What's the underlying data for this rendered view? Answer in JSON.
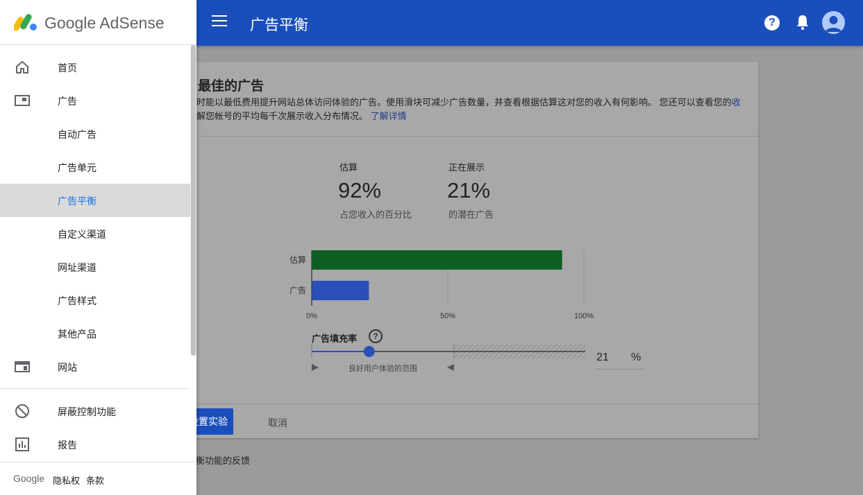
{
  "app": {
    "brand": "Google AdSense"
  },
  "topbar": {
    "title": "广告平衡"
  },
  "sidebar": {
    "items": [
      {
        "label": "首页",
        "icon": "home-icon"
      },
      {
        "label": "广告",
        "icon": "ads-icon"
      },
      {
        "label": "自动广告"
      },
      {
        "label": "广告单元"
      },
      {
        "label": "广告平衡",
        "active": true
      },
      {
        "label": "自定义渠道"
      },
      {
        "label": "网址渠道"
      },
      {
        "label": "广告样式"
      },
      {
        "label": "其他产品"
      },
      {
        "label": "网站",
        "icon": "sites-icon"
      },
      {
        "label": "屏蔽控制功能",
        "icon": "block-icon"
      },
      {
        "label": "报告",
        "icon": "reports-icon"
      }
    ],
    "footer": {
      "google": "Google",
      "privacy": "隐私权",
      "terms": "条款"
    }
  },
  "card": {
    "title": "最佳的广告",
    "desc_line1": "时能以最低费用提升网站总体访问体验的广告。使用滑块可减少广告数量，并查看根据估算这对您的收入有何影响。 您还可以查看您的",
    "desc_line1_link": "收",
    "desc_line2": "解您帐号的平均每千次展示收入分布情况。",
    "learn_more": "了解详情",
    "estimate": {
      "label": "估算",
      "value": "92%",
      "sub": "占您收入的百分比"
    },
    "showing": {
      "label": "正在展示",
      "value": "21%",
      "sub": "的潜在广告"
    },
    "fill_rate_label": "广告填充率",
    "fill_rate_value": "21",
    "fill_rate_unit": "%",
    "range_label": "良好用户体验的范围",
    "setup_button": "设置实验",
    "cancel_button": "取消",
    "feedback": "平衡功能的反馈"
  },
  "chart_data": {
    "type": "bar",
    "orientation": "horizontal",
    "categories": [
      "估算",
      "广告"
    ],
    "values": [
      92,
      21
    ],
    "colors": [
      "#0d5f24",
      "#2a4fb8"
    ],
    "xlim": [
      0,
      100
    ],
    "xticks": [
      "0%",
      "50%",
      "100%"
    ]
  },
  "slider": {
    "value": 21,
    "range_start": 0,
    "range_end": 52,
    "track_color": "#2a4fb8"
  },
  "colors": {
    "topbar": "#1a4fbb",
    "active_text": "#1a73e8",
    "active_bg": "#dadada"
  }
}
